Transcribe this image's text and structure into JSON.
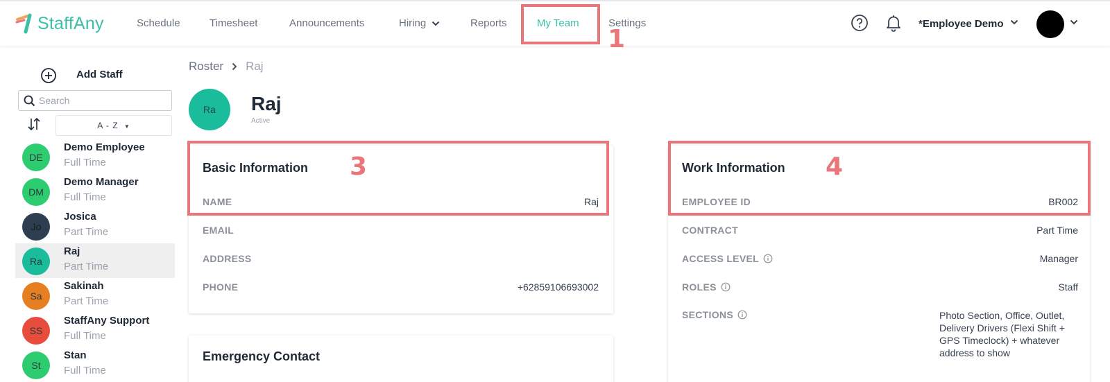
{
  "app": {
    "brand": "StaffAny",
    "accent": "#3bbfa7",
    "annotation_color": "#e8767a"
  },
  "nav": {
    "items": [
      {
        "label": "Schedule"
      },
      {
        "label": "Timesheet"
      },
      {
        "label": "Announcements"
      },
      {
        "label": "Hiring"
      },
      {
        "label": "Reports"
      },
      {
        "label": "My Team"
      },
      {
        "label": "Settings"
      }
    ],
    "active": "My Team",
    "account_name": "*Employee Demo"
  },
  "annotations": {
    "nav_marker": "1",
    "basic_marker": "3",
    "work_marker": "4"
  },
  "sidebar": {
    "add_staff_label": "Add Staff",
    "search_placeholder": "Search",
    "sort_label": "A - Z",
    "staff": [
      {
        "initials": "DE",
        "name": "Demo Employee",
        "type": "Full Time",
        "color": "#2ecc71"
      },
      {
        "initials": "DM",
        "name": "Demo Manager",
        "type": "Full Time",
        "color": "#2ecc71"
      },
      {
        "initials": "Jo",
        "name": "Josica",
        "type": "Part Time",
        "color": "#2c3e50"
      },
      {
        "initials": "Ra",
        "name": "Raj",
        "type": "Part Time",
        "color": "#1abc9c",
        "selected": true
      },
      {
        "initials": "Sa",
        "name": "Sakinah",
        "type": "Part Time",
        "color": "#e67e22"
      },
      {
        "initials": "SS",
        "name": "StaffAny Support",
        "type": "Full Time",
        "color": "#e74c3c"
      },
      {
        "initials": "St",
        "name": "Stan",
        "type": "Full Time",
        "color": "#2ecc71"
      }
    ]
  },
  "breadcrumb": {
    "root": "Roster",
    "current": "Raj"
  },
  "profile": {
    "initials": "Ra",
    "name": "Raj",
    "status": "Active"
  },
  "basic_info": {
    "title": "Basic Information",
    "name_label": "NAME",
    "name_value": "Raj",
    "email_label": "EMAIL",
    "email_value": "",
    "address_label": "ADDRESS",
    "address_value": "",
    "phone_label": "PHONE",
    "phone_value": "+62859106693002"
  },
  "work_info": {
    "title": "Work Information",
    "employee_id_label": "EMPLOYEE ID",
    "employee_id_value": "BR002",
    "contract_label": "CONTRACT",
    "contract_value": "Part Time",
    "access_label": "ACCESS LEVEL",
    "access_value": "Manager",
    "roles_label": "ROLES",
    "roles_value": "Staff",
    "sections_label": "SECTIONS",
    "sections_value": "Photo Section, Office, Outlet, Delivery Drivers (Flexi Shift + GPS Timeclock) + whatever address to show"
  },
  "emergency": {
    "title": "Emergency Contact"
  }
}
